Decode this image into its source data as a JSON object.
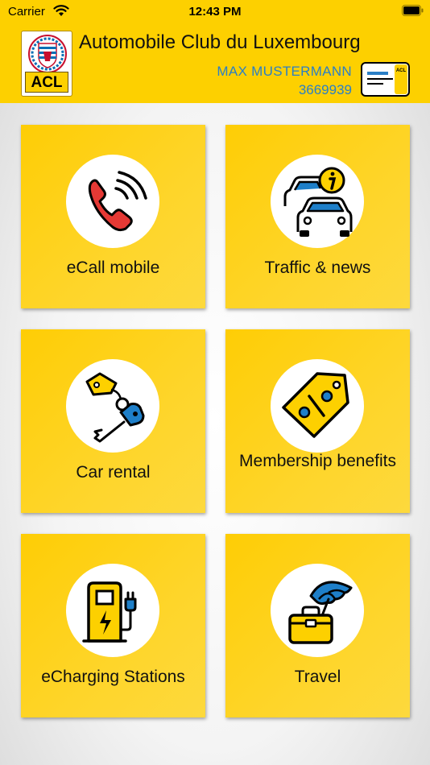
{
  "status_bar": {
    "carrier": "Carrier",
    "time": "12:43 PM"
  },
  "header": {
    "logo_text": "ACL",
    "title": "Automobile Club du Luxembourg",
    "member_name": "MAX MUSTERMANN",
    "member_number": "3669939",
    "card_brand": "ACL"
  },
  "tiles": [
    {
      "label": "eCall mobile",
      "icon": "phone-call-icon"
    },
    {
      "label": "Traffic & news",
      "icon": "traffic-info-icon"
    },
    {
      "label": "Car rental",
      "icon": "car-key-icon"
    },
    {
      "label": "Membership benefits",
      "icon": "discount-tag-icon"
    },
    {
      "label": "eCharging Stations",
      "icon": "charging-station-icon"
    },
    {
      "label": "Travel",
      "icon": "travel-umbrella-icon"
    }
  ],
  "colors": {
    "brand_yellow": "#fdd000",
    "member_blue": "#2a7fc7",
    "icon_red": "#e53935",
    "icon_blue": "#1e7fc9"
  }
}
